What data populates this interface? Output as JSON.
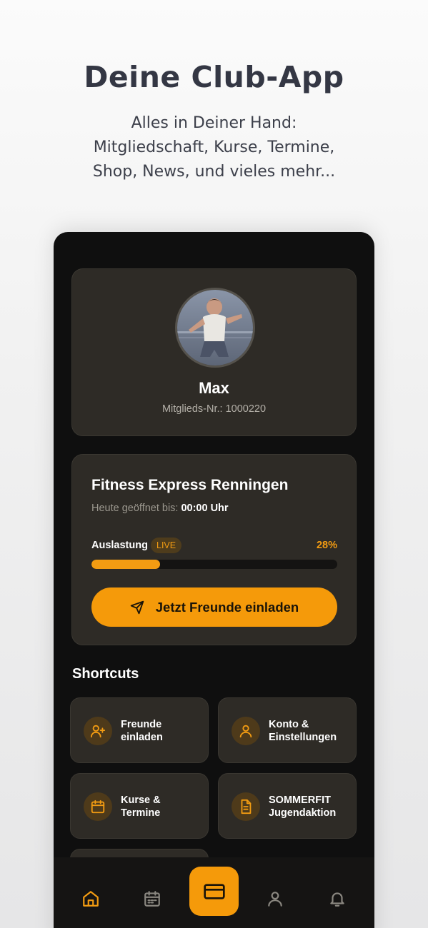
{
  "hero": {
    "title": "Deine Club-App",
    "subtitle_lines": [
      "Alles in Deiner Hand:",
      "Mitgliedschaft, Kurse, Termine,",
      "Shop, News, und vieles mehr..."
    ]
  },
  "profile": {
    "name": "Max",
    "member_label": "Mitglieds-Nr.:",
    "member_number": "1000220"
  },
  "studio": {
    "name": "Fitness Express Renningen",
    "open_label": "Heute geöffnet bis:",
    "open_until": "00:00 Uhr",
    "load_label": "Auslastung",
    "live_badge": "LIVE",
    "load_percent_text": "28%",
    "load_fraction": 0.28,
    "invite_button": "Jetzt Freunde einladen"
  },
  "shortcuts": {
    "title": "Shortcuts",
    "items": [
      {
        "icon": "user-plus-icon",
        "label_lines": [
          "Freunde",
          "einladen"
        ]
      },
      {
        "icon": "user-icon",
        "label_lines": [
          "Konto &",
          "Einstellungen"
        ]
      },
      {
        "icon": "calendar-icon",
        "label_lines": [
          "Kurse &",
          "Termine"
        ]
      },
      {
        "icon": "document-icon",
        "label_lines": [
          "SOMMERFIT",
          "Jugendaktion"
        ]
      }
    ]
  },
  "nav": {
    "items": [
      "home-icon",
      "calendar-icon",
      "card-icon",
      "profile-icon",
      "bell-icon"
    ],
    "active": "home-icon"
  },
  "colors": {
    "accent": "#f59a0a",
    "card_bg": "#2e2b26",
    "screen_bg": "#0f0f0f"
  }
}
